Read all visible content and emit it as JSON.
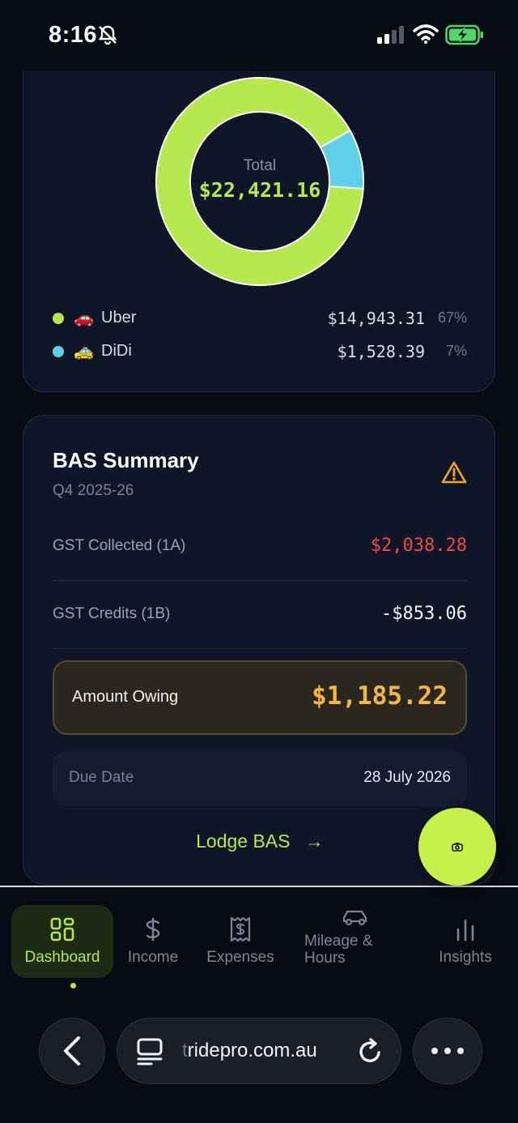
{
  "status_bar": {
    "time": "8:16"
  },
  "income_chart": {
    "total_label": "Total",
    "total_value": "$22,421.16",
    "legend": [
      {
        "emoji": "🚗",
        "name": "Uber",
        "value": "$14,943.31",
        "percent": "67%",
        "color": "#b6e94e"
      },
      {
        "emoji": "🚕",
        "name": "DiDi",
        "value": "$1,528.39",
        "percent": "7%",
        "color": "#5ed0e8"
      }
    ]
  },
  "bas_summary": {
    "title": "BAS Summary",
    "period": "Q4 2025-26",
    "rows": [
      {
        "label": "GST Collected (1A)",
        "value": "$2,038.28"
      },
      {
        "label": "GST Credits (1B)",
        "value": "-$853.06"
      }
    ],
    "amount_owing_label": "Amount Owing",
    "amount_owing_value": "$1,185.22",
    "due_date_label": "Due Date",
    "due_date_value": "28 July 2026",
    "lodge_label": "Lodge BAS",
    "lodge_arrow": "→"
  },
  "nav": {
    "items": [
      {
        "label": "Dashboard",
        "icon": "grid-icon",
        "active": true
      },
      {
        "label": "Income",
        "icon": "dollar-icon"
      },
      {
        "label": "Expenses",
        "icon": "receipt-icon"
      },
      {
        "label": "Mileage & Hours",
        "icon": "car-icon"
      },
      {
        "label": "Insights",
        "icon": "bar-chart-icon"
      }
    ]
  },
  "browser": {
    "url_prefix": "t",
    "url": "ridepro.com.au"
  },
  "colors": {
    "accent": "#b6e94e",
    "uber": "#b6e94e",
    "didi": "#5ed0e8",
    "danger": "#ee4a4a",
    "owing": "#f5b83d",
    "warning": "#f5a623"
  }
}
